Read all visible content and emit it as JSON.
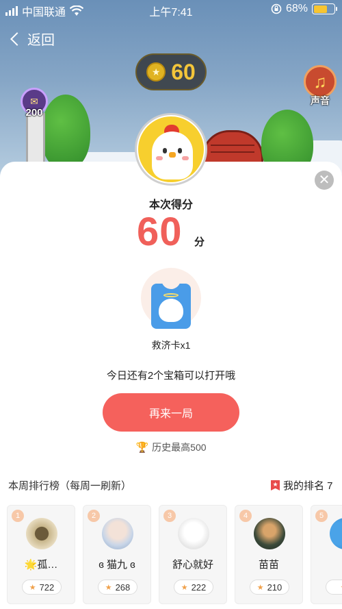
{
  "status_bar": {
    "carrier": "中国联通",
    "time": "上午7:41",
    "battery_percent": "68%",
    "battery_level": 0.68
  },
  "nav": {
    "back_label": "返回"
  },
  "game_hud": {
    "coin_score": "60",
    "sound_label": "声音",
    "badge_value": "200"
  },
  "result": {
    "title": "本次得分",
    "score": "60",
    "unit": "分",
    "reward_label": "救济卡x1",
    "chest_message": "今日还有2个宝箱可以打开哦",
    "again_button": "再来一局",
    "history_best": "历史最高500"
  },
  "leaderboard": {
    "title": "本周排行榜（每周一刷新）",
    "my_rank_label": "我的排名 7",
    "entries": [
      {
        "rank": "1",
        "name": "🌟孤…",
        "score": "722"
      },
      {
        "rank": "2",
        "name": "ɞ 猫九 ɞ",
        "score": "268"
      },
      {
        "rank": "3",
        "name": "舒心就好",
        "score": "222"
      },
      {
        "rank": "4",
        "name": "苗苗",
        "score": "210"
      },
      {
        "rank": "5",
        "name": "",
        "score": ""
      }
    ]
  },
  "colors": {
    "accent_red": "#f5615c",
    "score_red": "#f0605a",
    "gold": "#f3c53a"
  }
}
